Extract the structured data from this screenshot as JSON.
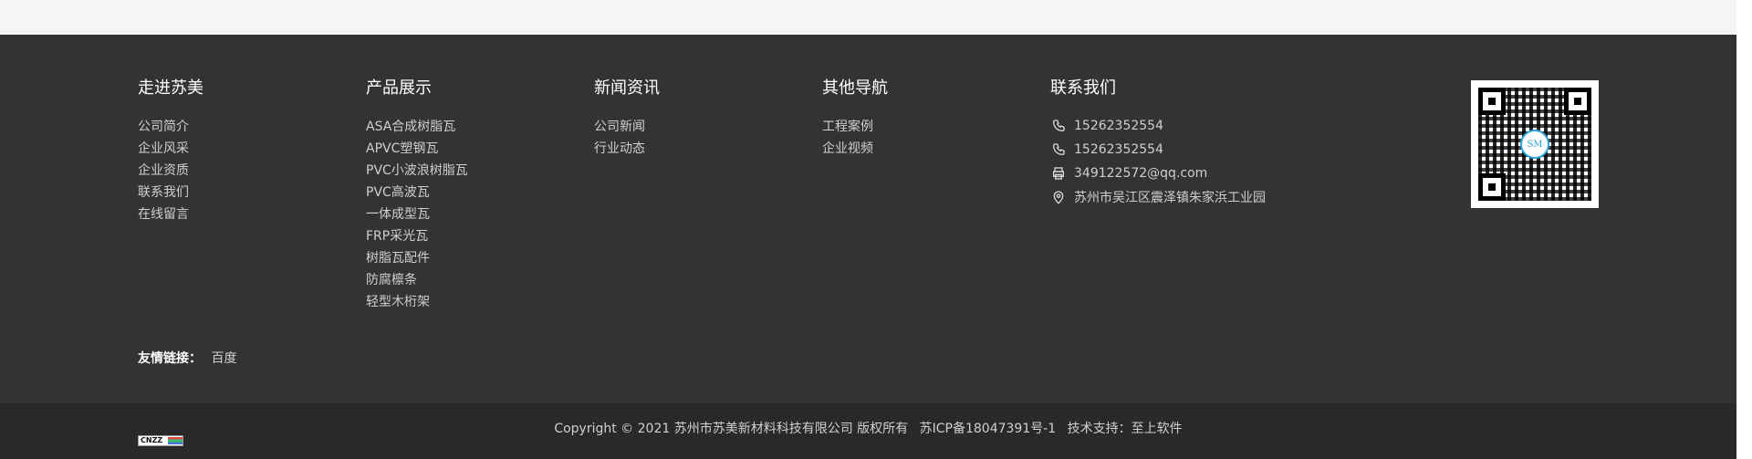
{
  "footer": {
    "columns": [
      {
        "title": "走进苏美",
        "links": [
          "公司简介",
          "企业风采",
          "企业资质",
          "联系我们",
          "在线留言"
        ]
      },
      {
        "title": "产品展示",
        "links": [
          "ASA合成树脂瓦",
          "APVC塑钢瓦",
          "PVC小波浪树脂瓦",
          "PVC高波瓦",
          "一体成型瓦",
          "FRP采光瓦",
          "树脂瓦配件",
          "防腐檩条",
          "轻型木桁架"
        ]
      },
      {
        "title": "新闻资讯",
        "links": [
          "公司新闻",
          "行业动态"
        ]
      },
      {
        "title": "其他导航",
        "links": [
          "工程案例",
          "企业视频"
        ]
      }
    ],
    "contact": {
      "title": "联系我们",
      "items": [
        {
          "icon": "phone-icon",
          "text": "15262352554"
        },
        {
          "icon": "phone-icon",
          "text": "15262352554"
        },
        {
          "icon": "printer-icon",
          "text": "349122572@qq.com"
        },
        {
          "icon": "location-icon",
          "text": "苏州市吴江区震泽镇朱家浜工业园"
        }
      ]
    },
    "friends": {
      "label": "友情链接：",
      "links": [
        "百度"
      ]
    }
  },
  "bottom_bar": {
    "copyright": "Copyright © 2021 苏州市苏美新材料科技有限公司 版权所有",
    "icp": "苏ICP备18047391号-1",
    "support": "技术支持：至上软件",
    "cnzz_badge": "CNZZ"
  },
  "qr": {
    "logo_text": "SM"
  },
  "colors": {
    "page_bg": "#f5f5f5",
    "footer_bg": "#333333",
    "bottom_bg": "#292929",
    "text": "#cfcfcf",
    "heading": "#ffffff",
    "qr_accent": "#2aa4d6"
  }
}
